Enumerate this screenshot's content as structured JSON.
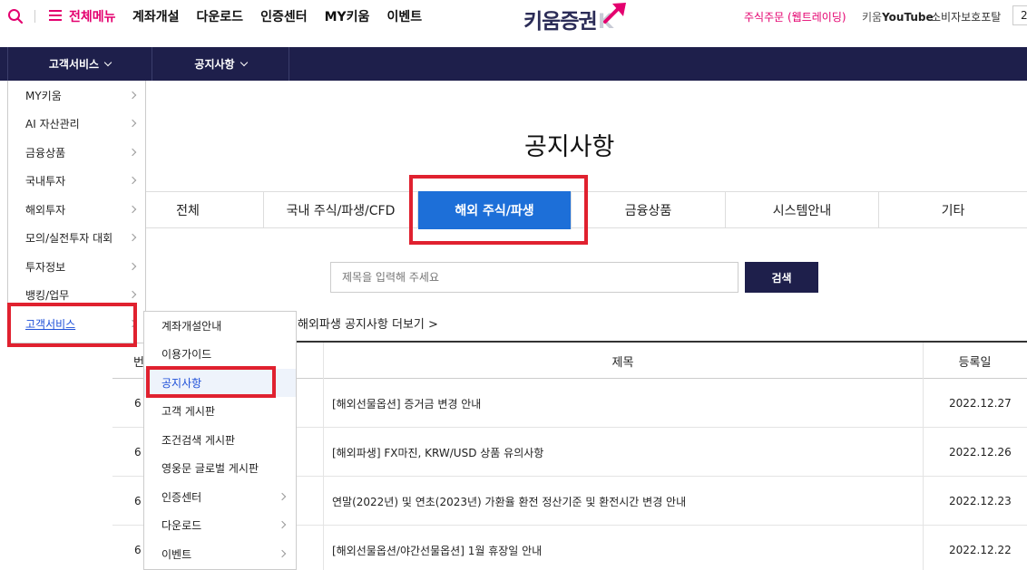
{
  "header": {
    "all_menu": "전체메뉴",
    "nav": [
      "계좌개설",
      "다운로드",
      "인증센터",
      "MY키움",
      "이벤트"
    ],
    "logo_text": "키움증권",
    "util_order": "주식주문 (웹트레이딩)",
    "util_youtube_prefix": "키움",
    "util_youtube": "YouTube",
    "util_consumer": "소비자보호포탈",
    "util_box": "2"
  },
  "navbar": {
    "item1": "고객서비스",
    "item2": "공지사항"
  },
  "main": {
    "title": "공지사항",
    "tabs": [
      "전체",
      "국내 주식/파생/CFD",
      "해외 주식/파생",
      "금융상품",
      "시스템안내",
      "기타"
    ],
    "active_tab": "해외 주식/파생",
    "search_placeholder": "제목을 입력해 주세요",
    "search_button": "검색",
    "more_link": "해외파생 공지사항 더보기 >"
  },
  "table": {
    "headers": [
      "번호",
      "제목",
      "등록일"
    ],
    "num_header_partial": "번",
    "rows": [
      {
        "num": "6",
        "title": "[해외선물옵션] 증거금 변경 안내",
        "date": "2022.12.27"
      },
      {
        "num": "6",
        "title": "[해외파생] FX마진, KRW/USD 상품 유의사항",
        "date": "2022.12.26"
      },
      {
        "num": "6",
        "title": "연말(2022년) 및 연초(2023년) 가환율 환전 정산기준 및 환전시간 변경 안내",
        "date": "2022.12.23"
      },
      {
        "num": "6",
        "title": "[해외선물옵션/야간선물옵션] 1월 휴장일 안내",
        "date": "2022.12.22"
      }
    ]
  },
  "menu1": {
    "items": [
      "MY키움",
      "AI 자산관리",
      "금융상품",
      "국내투자",
      "해외투자",
      "모의/실전투자 대회",
      "투자정보",
      "뱅킹/업무",
      "고객서비스"
    ],
    "active": "고객서비스"
  },
  "menu2": {
    "items": [
      "계좌개설안내",
      "이용가이드",
      "공지사항",
      "고객 게시판",
      "조건검색 게시판",
      "영웅문 글로벌 게시판",
      "인증센터",
      "다운로드",
      "이벤트"
    ],
    "active": "공지사항"
  },
  "colors": {
    "brand_pink": "#e4006f",
    "navy": "#1e1f4b",
    "active_tab_blue": "#1d6fd8",
    "highlight_red": "#e0212f"
  }
}
